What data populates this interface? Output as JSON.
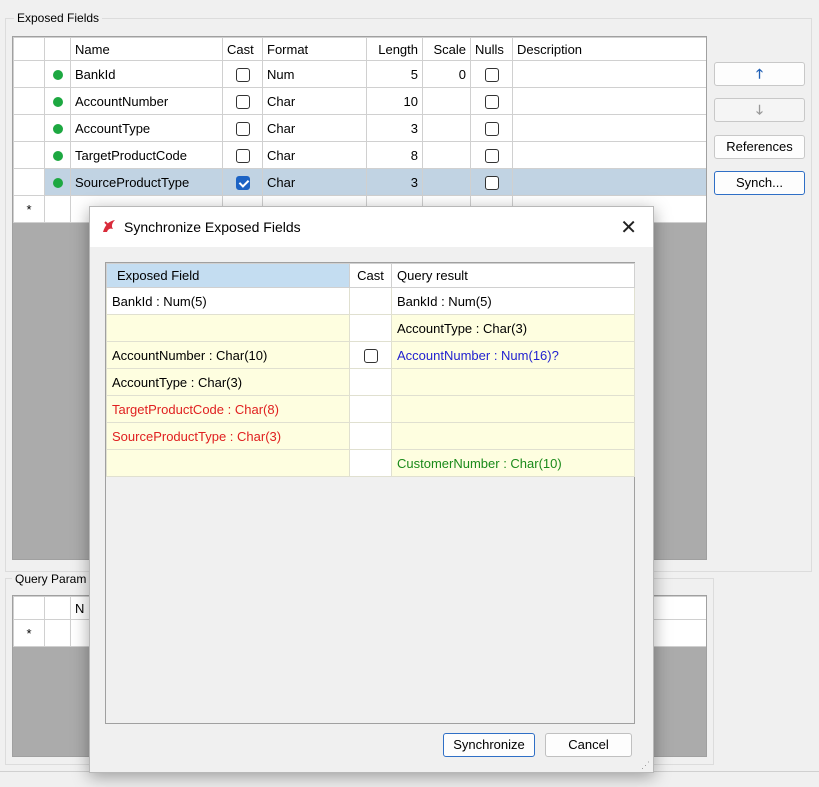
{
  "exposed_group": {
    "label": "Exposed Fields",
    "columns": [
      "Name",
      "Cast",
      "Format",
      "Length",
      "Scale",
      "Nulls",
      "Description"
    ],
    "rows": [
      {
        "name": "BankId",
        "cast": false,
        "format": "Num",
        "length": "5",
        "scale": "0",
        "nulls": false,
        "description": "",
        "selected": false
      },
      {
        "name": "AccountNumber",
        "cast": false,
        "format": "Char",
        "length": "10",
        "scale": "",
        "nulls": false,
        "description": "",
        "selected": false
      },
      {
        "name": "AccountType",
        "cast": false,
        "format": "Char",
        "length": "3",
        "scale": "",
        "nulls": false,
        "description": "",
        "selected": false
      },
      {
        "name": "TargetProductCode",
        "cast": false,
        "format": "Char",
        "length": "8",
        "scale": "",
        "nulls": false,
        "description": "",
        "selected": false
      },
      {
        "name": "SourceProductType",
        "cast": true,
        "format": "Char",
        "length": "3",
        "scale": "",
        "nulls": false,
        "description": "",
        "selected": true
      }
    ],
    "new_row_marker": "*"
  },
  "side_buttons": {
    "move_up_icon": "arrow-up-icon",
    "move_down_icon": "arrow-down-icon",
    "references_label": "References",
    "synch_label": "Synch..."
  },
  "query_group": {
    "label": "Query Param",
    "first_col_header": "N",
    "new_row_marker": "*"
  },
  "dialog": {
    "title": "Synchronize Exposed Fields",
    "app_icon": "app-logo-icon",
    "close_icon": "close-icon",
    "columns": [
      "Exposed Field",
      "Cast",
      "Query result"
    ],
    "rows": [
      {
        "exposed": "BankId : Num(5)",
        "exposed_color": "#000000",
        "cast": "",
        "query": "BankId : Num(5)",
        "query_color": "#000000",
        "style": "white"
      },
      {
        "exposed": "",
        "exposed_color": "#000000",
        "cast": "",
        "query": "AccountType : Char(3)",
        "query_color": "#000000",
        "style": "yellow"
      },
      {
        "exposed": "AccountNumber : Char(10)",
        "exposed_color": "#000000",
        "cast": "checkbox",
        "query": "AccountNumber : Num(16)?",
        "query_color": "#1f1fd0",
        "style": "yellow"
      },
      {
        "exposed": "AccountType : Char(3)",
        "exposed_color": "#000000",
        "cast": "",
        "query": "",
        "query_color": "#000000",
        "style": "yellow"
      },
      {
        "exposed": "TargetProductCode : Char(8)",
        "exposed_color": "#e02020",
        "cast": "",
        "query": "",
        "query_color": "#000000",
        "style": "yellow"
      },
      {
        "exposed": "SourceProductType : Char(3)",
        "exposed_color": "#e02020",
        "cast": "",
        "query": "",
        "query_color": "#000000",
        "style": "yellow"
      },
      {
        "exposed": "",
        "exposed_color": "#000000",
        "cast": "",
        "query": "CustomerNumber : Char(10)",
        "query_color": "#1a8a1a",
        "style": "yellow"
      }
    ],
    "synchronize_label": "Synchronize",
    "cancel_label": "Cancel"
  }
}
